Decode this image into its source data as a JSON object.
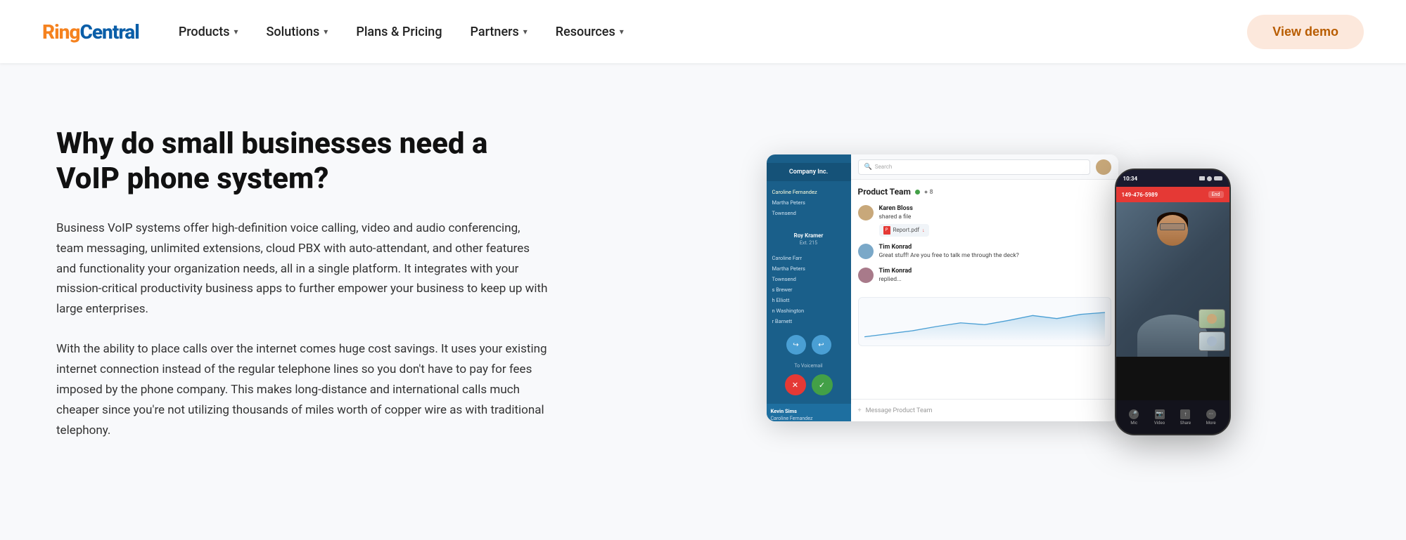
{
  "header": {
    "logo_ring": "Ring",
    "logo_central": "Central",
    "nav": [
      {
        "id": "products",
        "label": "Products",
        "has_dropdown": true
      },
      {
        "id": "solutions",
        "label": "Solutions",
        "has_dropdown": true
      },
      {
        "id": "plans",
        "label": "Plans & Pricing",
        "has_dropdown": false
      },
      {
        "id": "partners",
        "label": "Partners",
        "has_dropdown": true
      },
      {
        "id": "resources",
        "label": "Resources",
        "has_dropdown": true
      }
    ],
    "cta_label": "View demo"
  },
  "main": {
    "heading": "Why do small businesses need a VoIP phone system?",
    "paragraph1": "Business VoIP systems offer high-definition voice calling, video and audio conferencing, team messaging, unlimited extensions, cloud PBX with auto-attendant, and other features and functionality your organization needs, all in a single platform. It integrates with your mission-critical productivity business apps to further empower your business to keep up with large enterprises.",
    "paragraph2": "With the ability to place calls over the internet comes huge cost savings. It uses your existing internet connection instead of the regular telephone lines so you don't have to pay for fees imposed by the phone company. This makes long-distance and international calls much cheaper since you're not utilizing thousands of miles worth of copper wire as with traditional telephony."
  },
  "app_mockup": {
    "company_name": "Company Inc.",
    "search_placeholder": "Search",
    "contact_name": "Roy Kramer",
    "contact_ext": "Ext. 215",
    "channel_name": "Product Team",
    "message1_sender": "Karen Bloss",
    "message1_text": "shared a file",
    "file_name": "Report.pdf",
    "message2_sender": "Tim Konrad",
    "message2_text": "Great stuff! Are you free to talk me through the deck?",
    "message3_sender": "Tim Konrad",
    "message3_text": "replied...",
    "input_placeholder": "Message Product Team",
    "contacts": [
      "Caroline Fernandez",
      "Martha Peters",
      "Townsend",
      "Caroline Farr",
      "Martha Peters",
      "Townsend",
      "s Brewer",
      "h Elliott",
      "n Washington",
      "r Barnett"
    ],
    "highlight_contact": "Kevin Sims",
    "highlight_sub": "Caroline Fernandez\nMartha Peters"
  },
  "phone_mockup": {
    "time": "10:34",
    "number": "149-476-5989",
    "end_label": "End",
    "bottom_icons": [
      {
        "id": "mic",
        "label": "Mic"
      },
      {
        "id": "video",
        "label": "Video"
      },
      {
        "id": "share",
        "label": "Share screen"
      },
      {
        "id": "more",
        "label": "More"
      }
    ]
  },
  "icons": {
    "search": "🔍",
    "chevron_down": "▾",
    "forward": "↪",
    "reply": "↩",
    "phone": "📞",
    "message": "💬",
    "mic": "🎤",
    "video_cam": "📷",
    "file": "📄"
  },
  "colors": {
    "accent_orange": "#f5821f",
    "accent_blue": "#0a5ea8",
    "nav_blue": "#1a5f8a",
    "cta_bg": "#fce8dc",
    "cta_color": "#b85c00",
    "green": "#43a047",
    "red": "#e53935",
    "text_dark": "#111",
    "text_body": "#333"
  }
}
